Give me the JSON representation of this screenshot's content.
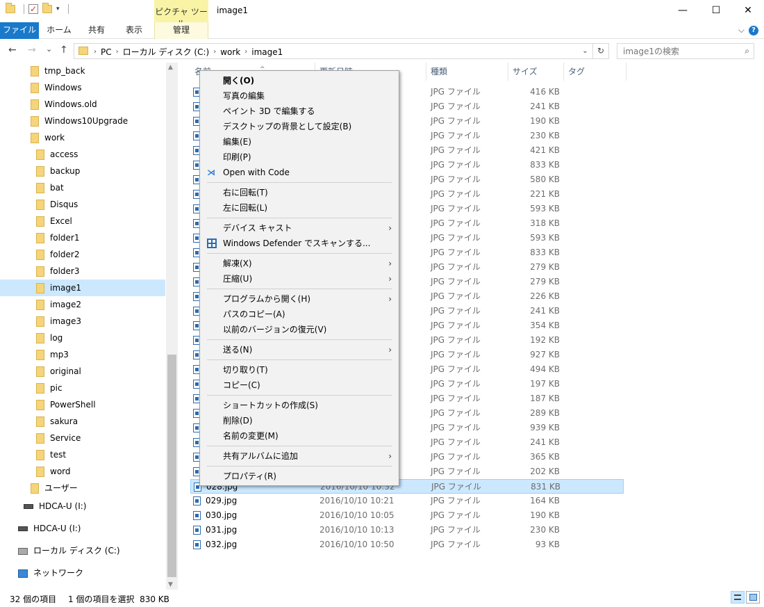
{
  "window": {
    "title": "image1",
    "context_tab_header": "ピクチャ ツール",
    "minimize": "—",
    "maximize": "☐",
    "close": "✕"
  },
  "ribbon": {
    "tabs": [
      "ファイル",
      "ホーム",
      "共有",
      "表示",
      "管理"
    ],
    "collapse_chevron": "⌵",
    "help": "?"
  },
  "nav": {
    "back": "←",
    "forward": "→",
    "recent": "⌄",
    "up": "↑",
    "breadcrumbs": [
      "PC",
      "ローカル ディスク (C:)",
      "work",
      "image1"
    ],
    "crumb_sep": "›",
    "address_dropdown": "⌄",
    "refresh": "↻",
    "search_placeholder": "image1の検索",
    "search_icon": "⌕"
  },
  "tree": [
    {
      "label": "tmp_back",
      "icon": "folder"
    },
    {
      "label": "Windows",
      "icon": "folder"
    },
    {
      "label": "Windows.old",
      "icon": "folder"
    },
    {
      "label": "Windows10Upgrade",
      "icon": "folder"
    },
    {
      "label": "work",
      "icon": "folder"
    },
    {
      "label": "access",
      "icon": "folder"
    },
    {
      "label": "backup",
      "icon": "folder"
    },
    {
      "label": "bat",
      "icon": "folder"
    },
    {
      "label": "Disqus",
      "icon": "folder"
    },
    {
      "label": "Excel",
      "icon": "folder"
    },
    {
      "label": "folder1",
      "icon": "folder"
    },
    {
      "label": "folder2",
      "icon": "folder"
    },
    {
      "label": "folder3",
      "icon": "folder"
    },
    {
      "label": "image1",
      "icon": "folder",
      "selected": true
    },
    {
      "label": "image2",
      "icon": "folder"
    },
    {
      "label": "image3",
      "icon": "folder"
    },
    {
      "label": "log",
      "icon": "folder"
    },
    {
      "label": "mp3",
      "icon": "folder"
    },
    {
      "label": "original",
      "icon": "folder"
    },
    {
      "label": "pic",
      "icon": "folder"
    },
    {
      "label": "PowerShell",
      "icon": "folder"
    },
    {
      "label": "sakura",
      "icon": "folder"
    },
    {
      "label": "Service",
      "icon": "folder"
    },
    {
      "label": "test",
      "icon": "folder"
    },
    {
      "label": "word",
      "icon": "folder"
    },
    {
      "label": "ユーザー",
      "icon": "folder"
    },
    {
      "label": "HDCA-U (I:)",
      "icon": "drive"
    },
    {
      "label": "HDCA-U (I:)",
      "icon": "drive"
    },
    {
      "label": "ローカル ディスク (C:)",
      "icon": "cdrive"
    },
    {
      "label": "ネットワーク",
      "icon": "network"
    }
  ],
  "columns": {
    "name": "名前",
    "date": "更新日時",
    "type": "種類",
    "size": "サイズ",
    "tag": "タグ",
    "sort_indicator": "^"
  },
  "files": [
    {
      "name": "",
      "date": "",
      "type": "JPG ファイル",
      "size": "416 KB"
    },
    {
      "name": "",
      "date": "",
      "type": "JPG ファイル",
      "size": "241 KB"
    },
    {
      "name": "",
      "date": "",
      "type": "JPG ファイル",
      "size": "190 KB"
    },
    {
      "name": "",
      "date": "",
      "type": "JPG ファイル",
      "size": "230 KB"
    },
    {
      "name": "",
      "date": "",
      "type": "JPG ファイル",
      "size": "421 KB"
    },
    {
      "name": "",
      "date": "",
      "type": "JPG ファイル",
      "size": "833 KB"
    },
    {
      "name": "",
      "date": "",
      "type": "JPG ファイル",
      "size": "580 KB"
    },
    {
      "name": "",
      "date": "",
      "type": "JPG ファイル",
      "size": "221 KB"
    },
    {
      "name": "",
      "date": "",
      "type": "JPG ファイル",
      "size": "593 KB"
    },
    {
      "name": "",
      "date": "",
      "type": "JPG ファイル",
      "size": "318 KB"
    },
    {
      "name": "",
      "date": "",
      "type": "JPG ファイル",
      "size": "593 KB"
    },
    {
      "name": "",
      "date": "",
      "type": "JPG ファイル",
      "size": "833 KB"
    },
    {
      "name": "",
      "date": "",
      "type": "JPG ファイル",
      "size": "279 KB"
    },
    {
      "name": "",
      "date": "",
      "type": "JPG ファイル",
      "size": "279 KB"
    },
    {
      "name": "",
      "date": "",
      "type": "JPG ファイル",
      "size": "226 KB"
    },
    {
      "name": "",
      "date": "",
      "type": "JPG ファイル",
      "size": "241 KB"
    },
    {
      "name": "",
      "date": "",
      "type": "JPG ファイル",
      "size": "354 KB"
    },
    {
      "name": "",
      "date": "",
      "type": "JPG ファイル",
      "size": "192 KB"
    },
    {
      "name": "",
      "date": "",
      "type": "JPG ファイル",
      "size": "927 KB"
    },
    {
      "name": "",
      "date": "",
      "type": "JPG ファイル",
      "size": "494 KB"
    },
    {
      "name": "",
      "date": "",
      "type": "JPG ファイル",
      "size": "197 KB"
    },
    {
      "name": "",
      "date": "",
      "type": "JPG ファイル",
      "size": "187 KB"
    },
    {
      "name": "",
      "date": "",
      "type": "JPG ファイル",
      "size": "289 KB"
    },
    {
      "name": "",
      "date": "",
      "type": "JPG ファイル",
      "size": "939 KB"
    },
    {
      "name": "",
      "date": "",
      "type": "JPG ファイル",
      "size": "241 KB"
    },
    {
      "name": "",
      "date": "",
      "type": "JPG ファイル",
      "size": "365 KB"
    },
    {
      "name": "",
      "date": "",
      "type": "JPG ファイル",
      "size": "202 KB"
    },
    {
      "name": "028.jpg",
      "date": "2016/10/10 10:32",
      "type": "JPG ファイル",
      "size": "831 KB",
      "selected": true
    },
    {
      "name": "029.jpg",
      "date": "2016/10/10 10:21",
      "type": "JPG ファイル",
      "size": "164 KB"
    },
    {
      "name": "030.jpg",
      "date": "2016/10/10 10:05",
      "type": "JPG ファイル",
      "size": "190 KB"
    },
    {
      "name": "031.jpg",
      "date": "2016/10/10 10:13",
      "type": "JPG ファイル",
      "size": "230 KB"
    },
    {
      "name": "032.jpg",
      "date": "2016/10/10 10:50",
      "type": "JPG ファイル",
      "size": "93 KB"
    }
  ],
  "context_menu": {
    "items": [
      {
        "label": "開く(O)",
        "bold": true
      },
      {
        "label": "写真の編集"
      },
      {
        "label": "ペイント 3D で編集する"
      },
      {
        "label": "デスクトップの背景として設定(B)"
      },
      {
        "label": "編集(E)"
      },
      {
        "label": "印刷(P)"
      },
      {
        "label": "Open with Code",
        "icon": "vscode"
      },
      {
        "sep": true
      },
      {
        "label": "右に回転(T)"
      },
      {
        "label": "左に回転(L)"
      },
      {
        "sep": true
      },
      {
        "label": "デバイス キャスト",
        "submenu": true
      },
      {
        "label": "Windows Defender でスキャンする...",
        "icon": "defender"
      },
      {
        "sep": true
      },
      {
        "label": "解凍(X)",
        "submenu": true
      },
      {
        "label": "圧縮(U)",
        "submenu": true
      },
      {
        "sep": true
      },
      {
        "label": "プログラムから開く(H)",
        "submenu": true
      },
      {
        "label": "パスのコピー(A)"
      },
      {
        "label": "以前のバージョンの復元(V)"
      },
      {
        "sep": true
      },
      {
        "label": "送る(N)",
        "submenu": true
      },
      {
        "sep": true
      },
      {
        "label": "切り取り(T)"
      },
      {
        "label": "コピー(C)"
      },
      {
        "sep": true
      },
      {
        "label": "ショートカットの作成(S)"
      },
      {
        "label": "削除(D)"
      },
      {
        "label": "名前の変更(M)"
      },
      {
        "sep": true
      },
      {
        "label": "共有アルバムに追加",
        "submenu": true
      },
      {
        "sep": true
      },
      {
        "label": "プロパティ(R)"
      }
    ],
    "submenu_arrow": "›",
    "vscode_glyph": "⋊"
  },
  "status": {
    "item_count": "32 個の項目",
    "selection": "1 個の項目を選択  830 KB"
  },
  "colors": {
    "accent": "#1979ca",
    "selection": "#cce8ff",
    "context_tab": "#f9f4a5"
  }
}
